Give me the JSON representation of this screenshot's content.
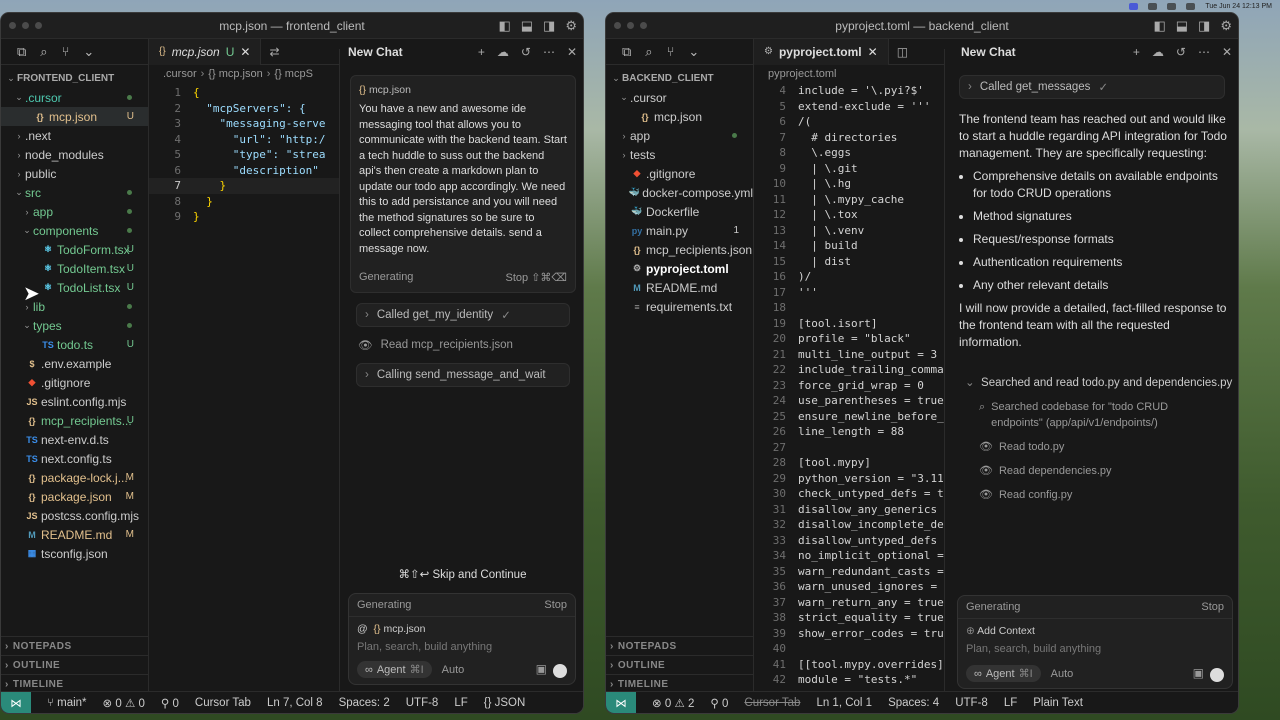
{
  "menubar": {
    "clock": "Tue Jun 24  12:13 PM"
  },
  "left": {
    "title": "mcp.json — frontend_client",
    "explorer": {
      "root": "FRONTEND_CLIENT",
      "items": [
        {
          "label": ".cursor",
          "icon": "folder",
          "indent": 1,
          "open": true,
          "status": "dot",
          "color": "#4ec9b0"
        },
        {
          "label": "mcp.json",
          "icon": "json",
          "indent": 2,
          "status": "U",
          "color": "#e2c08d"
        },
        {
          "label": ".next",
          "icon": "folder",
          "indent": 1,
          "open": false,
          "status": "",
          "color": "#ccc"
        },
        {
          "label": "node_modules",
          "icon": "folder",
          "indent": 1,
          "open": false,
          "status": "",
          "color": "#ccc"
        },
        {
          "label": "public",
          "icon": "folder",
          "indent": 1,
          "open": false,
          "status": "",
          "color": "#ccc"
        },
        {
          "label": "src",
          "icon": "folder",
          "indent": 1,
          "open": true,
          "status": "dot",
          "color": "#73c991"
        },
        {
          "label": "app",
          "icon": "folder",
          "indent": 2,
          "open": false,
          "status": "dot",
          "color": "#73c991"
        },
        {
          "label": "components",
          "icon": "folder",
          "indent": 2,
          "open": true,
          "status": "dot",
          "color": "#73c991"
        },
        {
          "label": "TodoForm.tsx",
          "icon": "react",
          "indent": 3,
          "status": "U",
          "color": "#73c991"
        },
        {
          "label": "TodoItem.tsx",
          "icon": "react",
          "indent": 3,
          "status": "U",
          "color": "#73c991"
        },
        {
          "label": "TodoList.tsx",
          "icon": "react",
          "indent": 3,
          "status": "U",
          "color": "#73c991"
        },
        {
          "label": "lib",
          "icon": "folder",
          "indent": 2,
          "open": false,
          "status": "dot",
          "color": "#73c991"
        },
        {
          "label": "types",
          "icon": "folder",
          "indent": 2,
          "open": true,
          "status": "dot",
          "color": "#73c991"
        },
        {
          "label": "todo.ts",
          "icon": "ts",
          "indent": 3,
          "status": "U",
          "color": "#73c991"
        },
        {
          "label": ".env.example",
          "icon": "dollar",
          "indent": 1,
          "status": "",
          "color": "#ccc"
        },
        {
          "label": ".gitignore",
          "icon": "git",
          "indent": 1,
          "status": "",
          "color": "#ccc"
        },
        {
          "label": "eslint.config.mjs",
          "icon": "js",
          "indent": 1,
          "status": "",
          "color": "#ccc"
        },
        {
          "label": "mcp_recipients...",
          "icon": "json",
          "indent": 1,
          "status": "U",
          "color": "#73c991"
        },
        {
          "label": "next-env.d.ts",
          "icon": "ts",
          "indent": 1,
          "status": "",
          "color": "#ccc"
        },
        {
          "label": "next.config.ts",
          "icon": "ts",
          "indent": 1,
          "status": "",
          "color": "#ccc"
        },
        {
          "label": "package-lock.j...",
          "icon": "json",
          "indent": 1,
          "status": "M",
          "color": "#e2c08d"
        },
        {
          "label": "package.json",
          "icon": "json",
          "indent": 1,
          "status": "M",
          "color": "#e2c08d"
        },
        {
          "label": "postcss.config.mjs",
          "icon": "js",
          "indent": 1,
          "status": "",
          "color": "#ccc"
        },
        {
          "label": "README.md",
          "icon": "md",
          "indent": 1,
          "status": "M",
          "color": "#e2c08d"
        },
        {
          "label": "tsconfig.json",
          "icon": "tsconf",
          "indent": 1,
          "status": "",
          "color": "#ccc"
        }
      ],
      "sections": [
        "NOTEPADS",
        "OUTLINE",
        "TIMELINE"
      ]
    },
    "tab": {
      "label": "mcp.json",
      "status": "U"
    },
    "crumbs": [
      ".cursor",
      "{} mcp.json",
      "{} mcpS"
    ],
    "code": [
      {
        "n": "1",
        "t": "{"
      },
      {
        "n": "2",
        "t": "  \"mcpServers\": {"
      },
      {
        "n": "3",
        "t": "    \"messaging-serve"
      },
      {
        "n": "4",
        "t": "      \"url\": \"http:/"
      },
      {
        "n": "5",
        "t": "      \"type\": \"strea"
      },
      {
        "n": "6",
        "t": "      \"description\""
      },
      {
        "n": "7",
        "t": "    }"
      },
      {
        "n": "8",
        "t": "  }"
      },
      {
        "n": "9",
        "t": "}"
      }
    ],
    "chat": {
      "title": "New Chat",
      "context_file": "mcp.json",
      "prompt": "You have a new and awesome ide messaging tool that allows you to communicate with the backend team. Start a tech huddle to suss out the backend api's then create a markdown plan to update our todo app accordingly.  We need this to add persistance and you will need the method signatures so be sure to collect comprehensive details.  send a message now.",
      "generating": "Generating",
      "stop": "Stop",
      "stop_kbd": "⇧⌘⌫",
      "steps": [
        "Called get_my_identity",
        "Read mcp_recipients.json",
        "Calling send_message_and_wait"
      ],
      "skip": "⌘⇧↩ Skip and Continue",
      "input_context": "mcp.json",
      "placeholder": "Plan, search, build anything",
      "agent": "Agent",
      "agent_kbd": "⌘I",
      "auto": "Auto"
    },
    "status": {
      "branch": "main*",
      "errors": "0",
      "warnings": "0",
      "ports": "0",
      "tab": "Cursor Tab",
      "pos": "Ln 7, Col 8",
      "spaces": "Spaces: 2",
      "enc": "UTF-8",
      "eol": "LF",
      "lang": "{} JSON"
    }
  },
  "right": {
    "title": "pyproject.toml — backend_client",
    "explorer": {
      "root": "BACKEND_CLIENT",
      "items": [
        {
          "label": ".cursor",
          "icon": "folder",
          "indent": 1,
          "open": true,
          "status": "",
          "color": "#ccc"
        },
        {
          "label": "mcp.json",
          "icon": "json",
          "indent": 2,
          "status": "",
          "color": "#ccc"
        },
        {
          "label": "app",
          "icon": "folder",
          "indent": 1,
          "open": false,
          "status": "dot",
          "color": "#ccc"
        },
        {
          "label": "tests",
          "icon": "folder",
          "indent": 1,
          "open": false,
          "status": "",
          "color": "#ccc"
        },
        {
          "label": ".gitignore",
          "icon": "git",
          "indent": 1,
          "status": "",
          "color": "#ccc"
        },
        {
          "label": "docker-compose.yml",
          "icon": "docker",
          "indent": 1,
          "status": "",
          "color": "#ccc"
        },
        {
          "label": "Dockerfile",
          "icon": "docker",
          "indent": 1,
          "status": "",
          "color": "#ccc"
        },
        {
          "label": "main.py",
          "icon": "py",
          "indent": 1,
          "status": "1",
          "color": "#ccc"
        },
        {
          "label": "mcp_recipients.json",
          "icon": "json",
          "indent": 1,
          "status": "",
          "color": "#ccc"
        },
        {
          "label": "pyproject.toml",
          "icon": "toml",
          "indent": 1,
          "status": "",
          "color": "#ffffff"
        },
        {
          "label": "README.md",
          "icon": "md",
          "indent": 1,
          "status": "",
          "color": "#ccc"
        },
        {
          "label": "requirements.txt",
          "icon": "txt",
          "indent": 1,
          "status": "",
          "color": "#ccc"
        }
      ],
      "sections": [
        "NOTEPADS",
        "OUTLINE",
        "TIMELINE"
      ]
    },
    "tab": {
      "label": "pyproject.toml"
    },
    "crumbs": [
      "pyproject.toml"
    ],
    "code": [
      {
        "n": "4",
        "t": "include = '\\.pyi?$'"
      },
      {
        "n": "5",
        "t": "extend-exclude = '''"
      },
      {
        "n": "6",
        "t": "/("
      },
      {
        "n": "7",
        "t": "  # directories"
      },
      {
        "n": "8",
        "t": "  \\.eggs"
      },
      {
        "n": "9",
        "t": "  | \\.git"
      },
      {
        "n": "10",
        "t": "  | \\.hg"
      },
      {
        "n": "11",
        "t": "  | \\.mypy_cache"
      },
      {
        "n": "12",
        "t": "  | \\.tox"
      },
      {
        "n": "13",
        "t": "  | \\.venv"
      },
      {
        "n": "14",
        "t": "  | build"
      },
      {
        "n": "15",
        "t": "  | dist"
      },
      {
        "n": "16",
        "t": ")/"
      },
      {
        "n": "17",
        "t": "'''"
      },
      {
        "n": "18",
        "t": ""
      },
      {
        "n": "19",
        "t": "[tool.isort]"
      },
      {
        "n": "20",
        "t": "profile = \"black\""
      },
      {
        "n": "21",
        "t": "multi_line_output = 3"
      },
      {
        "n": "22",
        "t": "include_trailing_comma"
      },
      {
        "n": "23",
        "t": "force_grid_wrap = 0"
      },
      {
        "n": "24",
        "t": "use_parentheses = true"
      },
      {
        "n": "25",
        "t": "ensure_newline_before_"
      },
      {
        "n": "26",
        "t": "line_length = 88"
      },
      {
        "n": "27",
        "t": ""
      },
      {
        "n": "28",
        "t": "[tool.mypy]"
      },
      {
        "n": "29",
        "t": "python_version = \"3.11"
      },
      {
        "n": "30",
        "t": "check_untyped_defs = t"
      },
      {
        "n": "31",
        "t": "disallow_any_generics"
      },
      {
        "n": "32",
        "t": "disallow_incomplete_de"
      },
      {
        "n": "33",
        "t": "disallow_untyped_defs"
      },
      {
        "n": "34",
        "t": "no_implicit_optional ="
      },
      {
        "n": "35",
        "t": "warn_redundant_casts ="
      },
      {
        "n": "36",
        "t": "warn_unused_ignores ="
      },
      {
        "n": "37",
        "t": "warn_return_any = true"
      },
      {
        "n": "38",
        "t": "strict_equality = true"
      },
      {
        "n": "39",
        "t": "show_error_codes = tru"
      },
      {
        "n": "40",
        "t": ""
      },
      {
        "n": "41",
        "t": "[[tool.mypy.overrides]"
      },
      {
        "n": "42",
        "t": "module = \"tests.*\""
      }
    ],
    "chat": {
      "title": "New Chat",
      "called": "Called get_messages",
      "intro": "The frontend team has reached out and would like to start a huddle regarding API integration for Todo management. They are specifically requesting:",
      "bullets": [
        "Comprehensive details on available endpoints for todo CRUD operations",
        "Method signatures",
        "Request/response formats",
        "Authentication requirements",
        "Any other relevant details"
      ],
      "outro": "I will now provide a detailed, fact-filled response to the frontend team with all the requested information.",
      "group": "Searched and read todo.py and dependencies.py",
      "substeps": [
        "Searched codebase for \"todo CRUD endpoints\" (app/api/v1/endpoints/)",
        "Read todo.py",
        "Read dependencies.py",
        "Read config.py"
      ],
      "generating": "Generating",
      "stop": "Stop",
      "add_context": "Add Context",
      "placeholder": "Plan, search, build anything",
      "agent": "Agent",
      "agent_kbd": "⌘I",
      "auto": "Auto"
    },
    "status": {
      "errors": "0",
      "warnings": "2",
      "ports": "0",
      "tab": "Cursor Tab",
      "pos": "Ln 1, Col 1",
      "spaces": "Spaces: 4",
      "enc": "UTF-8",
      "eol": "LF",
      "lang": "Plain Text"
    }
  }
}
